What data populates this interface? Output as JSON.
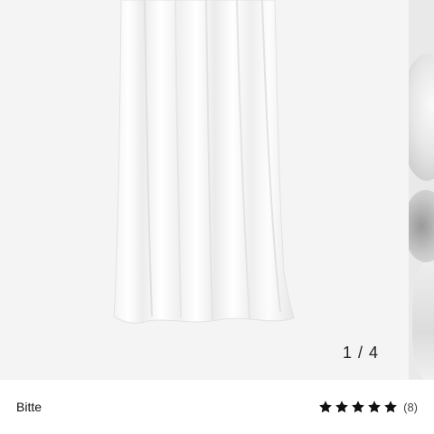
{
  "gallery": {
    "current_page": 1,
    "total_pages": 4,
    "page_indicator": "1 / 4"
  },
  "product": {
    "brand": "Bitte",
    "rating": {
      "stars_filled": 5,
      "stars_total": 5,
      "review_count": "(8)"
    }
  },
  "colors": {
    "background": "#ffffff",
    "image_background": "#f4f4f4",
    "star": "#111111",
    "text": "#111111"
  },
  "icons": {
    "rating_star": "star-icon"
  }
}
